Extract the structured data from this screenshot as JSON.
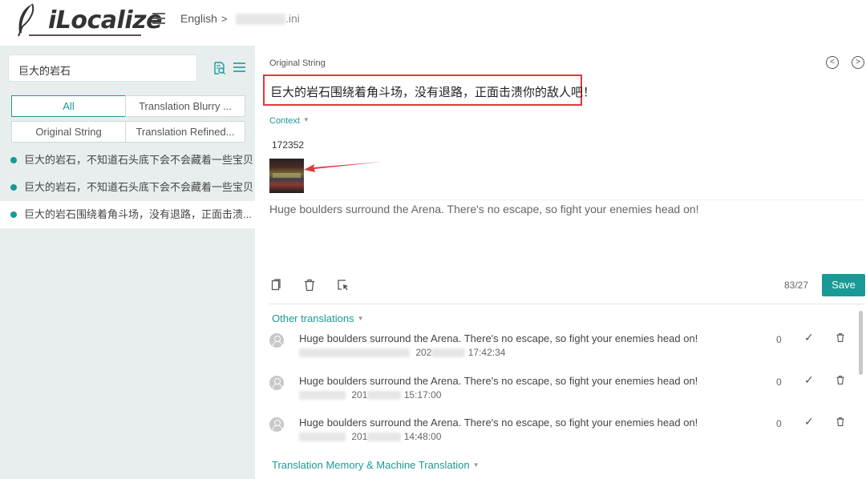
{
  "header": {
    "logo_text": "iLocalize",
    "breadcrumb_language": "English",
    "breadcrumb_separator": ">",
    "breadcrumb_file_suffix": ".ini"
  },
  "sidebar": {
    "search_value": "巨大的岩石",
    "filters": [
      {
        "label": "All"
      },
      {
        "label": "Translation Blurry ..."
      },
      {
        "label": "Original String"
      },
      {
        "label": "Translation Refined..."
      }
    ],
    "items": [
      {
        "label": "巨大的岩石，不知道石头底下会不会藏着一些宝贝"
      },
      {
        "label": "巨大的岩石，不知道石头底下会不会藏着一些宝贝"
      },
      {
        "label": "巨大的岩石围绕着角斗场，没有退路，正面击溃..."
      }
    ]
  },
  "editor": {
    "original_label": "Original String",
    "original_text": "巨大的岩石围绕着角斗场，没有退路，正面击溃你的敌人吧！",
    "context_label": "Context",
    "context_id": "172352",
    "translation_text": "Huge boulders surround the Arena. There's no escape, so fight your enemies head on!",
    "counter": "83/27",
    "save_label": "Save"
  },
  "other_translations": {
    "label": "Other translations",
    "rows": [
      {
        "text": "Huge boulders surround the Arena. There's no escape, so fight your enemies head on!",
        "date_prefix": "202",
        "time": "17:42:34",
        "votes": "0"
      },
      {
        "text": "Huge boulders surround the Arena. There's no escape, so fight your enemies head on!",
        "date_prefix": "201",
        "time": "15:17:00",
        "votes": "0"
      },
      {
        "text": "Huge boulders surround the Arena. There's no escape, so fight your enemies head on!",
        "date_prefix": "201",
        "time": "14:48:00",
        "votes": "0"
      }
    ]
  },
  "tm_section": {
    "label": "Translation Memory & Machine Translation"
  },
  "colors": {
    "accent": "#1a9a96",
    "highlight_border": "#e03a3a",
    "sidebar_bg": "#e8eeee"
  }
}
